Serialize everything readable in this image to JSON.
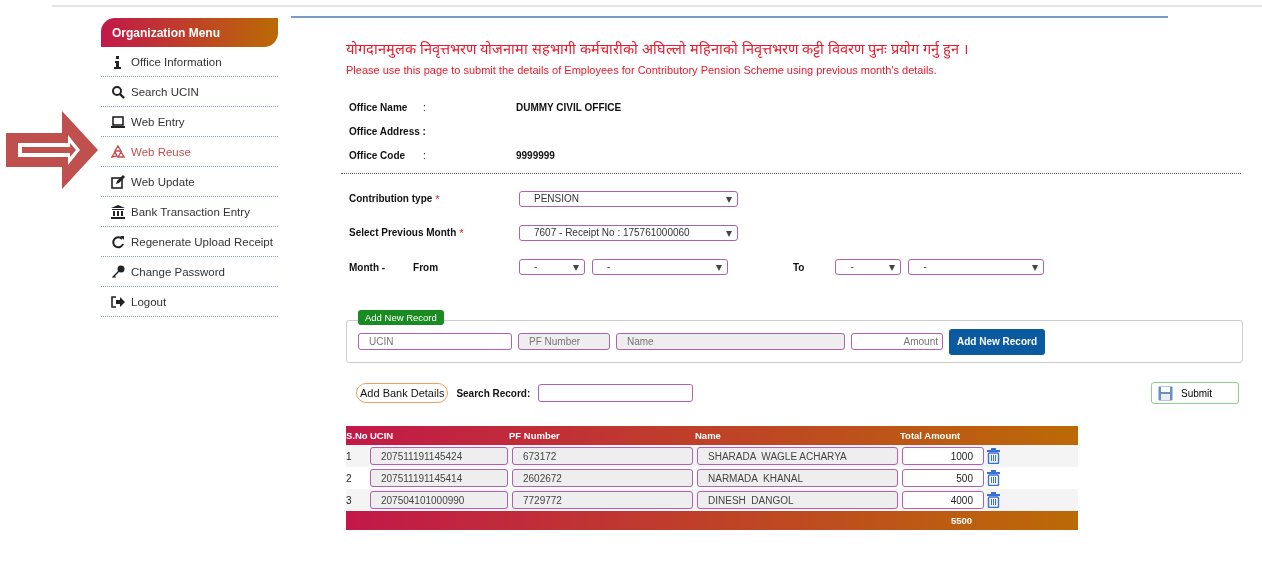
{
  "menu": {
    "title": "Organization Menu",
    "items": [
      {
        "label": "Office Information",
        "selected": false
      },
      {
        "label": "Search UCIN",
        "selected": false
      },
      {
        "label": "Web Entry",
        "selected": false
      },
      {
        "label": "Web Reuse",
        "selected": true
      },
      {
        "label": "Web Update",
        "selected": false
      },
      {
        "label": "Bank Transaction Entry",
        "selected": false
      },
      {
        "label": "Regenerate Upload Receipt",
        "selected": false
      },
      {
        "label": "Change Password",
        "selected": false
      },
      {
        "label": "Logout",
        "selected": false
      }
    ]
  },
  "heading": "योगदानमुलक निवृत्तभरण योजनामा सहभागी कर्मचारीको अघिल्लो महिनाको निवृत्तभरण कट्टी विवरण पुनः प्रयोग गर्नु हुन ।",
  "subheading": "Please use this page to submit the details of Employees for Contributory Pension Scheme using previous month's details.",
  "office": [
    {
      "label": "Office Name",
      "colon": ":",
      "value": "DUMMY CIVIL OFFICE"
    },
    {
      "label": "Office Address :"
    },
    {
      "label": "Office Code",
      "colon": ":",
      "value": "9999999"
    }
  ],
  "contribution_type": {
    "label": "Contribution type",
    "required_mark": "*",
    "value": "PENSION"
  },
  "previous_month": {
    "label": "Select Previous Month",
    "required_mark": "*",
    "value": "7607 - Receipt No : 175761000060"
  },
  "month_range": {
    "label": "Month -",
    "from_label": "From",
    "from_year": "-",
    "from_month": "-",
    "to_label": "To",
    "to_year": "-",
    "to_month": "-"
  },
  "new_record": {
    "legend": "Add New Record",
    "ucin_placeholder": "UCIN",
    "pf_placeholder": "PF Number",
    "name_placeholder": "Name",
    "amount_placeholder": "Amount",
    "button": "Add New Record"
  },
  "bank_details_button": "Add Bank Details",
  "search": {
    "label": "Search Record:"
  },
  "submit_button": "Submit",
  "table": {
    "columns": [
      "S.No",
      "UCIN",
      "PF Number",
      "Name",
      "Total Amount"
    ],
    "rows": [
      {
        "sno": "1",
        "ucin": "207511191145424",
        "pf_number": "673172",
        "name": "SHARADA  WAGLE ACHARYA",
        "amount": "1000"
      },
      {
        "sno": "2",
        "ucin": "207511191145414",
        "pf_number": "2602672",
        "name": "NARMADA  KHANAL",
        "amount": "500"
      },
      {
        "sno": "3",
        "ucin": "207504101000990",
        "pf_number": "7729772",
        "name": "DINESH  DANGOL",
        "amount": "4000"
      }
    ],
    "total": "5500"
  }
}
